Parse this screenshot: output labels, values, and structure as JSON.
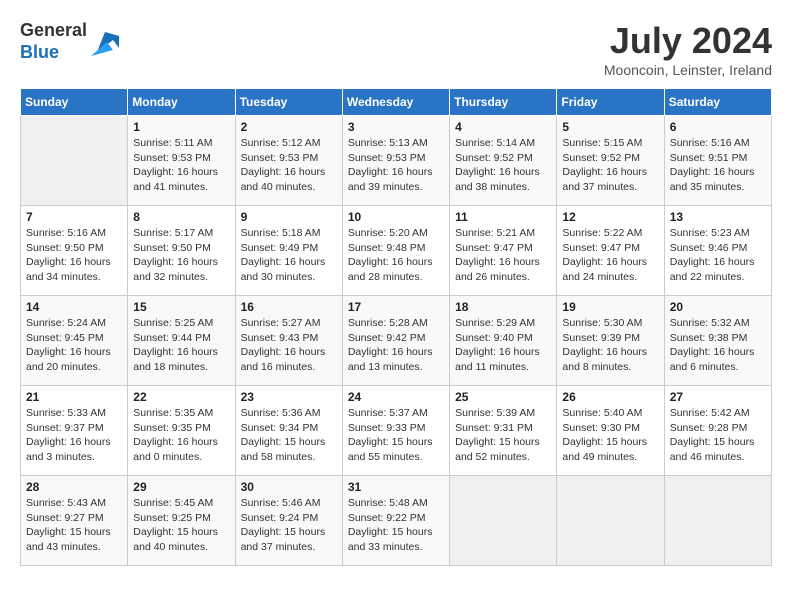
{
  "header": {
    "logo_general": "General",
    "logo_blue": "Blue",
    "month_year": "July 2024",
    "location": "Mooncoin, Leinster, Ireland"
  },
  "days_of_week": [
    "Sunday",
    "Monday",
    "Tuesday",
    "Wednesday",
    "Thursday",
    "Friday",
    "Saturday"
  ],
  "weeks": [
    [
      {
        "day": "",
        "empty": true
      },
      {
        "day": "1",
        "sunrise": "5:11 AM",
        "sunset": "9:53 PM",
        "daylight": "16 hours and 41 minutes."
      },
      {
        "day": "2",
        "sunrise": "5:12 AM",
        "sunset": "9:53 PM",
        "daylight": "16 hours and 40 minutes."
      },
      {
        "day": "3",
        "sunrise": "5:13 AM",
        "sunset": "9:53 PM",
        "daylight": "16 hours and 39 minutes."
      },
      {
        "day": "4",
        "sunrise": "5:14 AM",
        "sunset": "9:52 PM",
        "daylight": "16 hours and 38 minutes."
      },
      {
        "day": "5",
        "sunrise": "5:15 AM",
        "sunset": "9:52 PM",
        "daylight": "16 hours and 37 minutes."
      },
      {
        "day": "6",
        "sunrise": "5:16 AM",
        "sunset": "9:51 PM",
        "daylight": "16 hours and 35 minutes."
      }
    ],
    [
      {
        "day": "7",
        "sunrise": "5:16 AM",
        "sunset": "9:50 PM",
        "daylight": "16 hours and 34 minutes."
      },
      {
        "day": "8",
        "sunrise": "5:17 AM",
        "sunset": "9:50 PM",
        "daylight": "16 hours and 32 minutes."
      },
      {
        "day": "9",
        "sunrise": "5:18 AM",
        "sunset": "9:49 PM",
        "daylight": "16 hours and 30 minutes."
      },
      {
        "day": "10",
        "sunrise": "5:20 AM",
        "sunset": "9:48 PM",
        "daylight": "16 hours and 28 minutes."
      },
      {
        "day": "11",
        "sunrise": "5:21 AM",
        "sunset": "9:47 PM",
        "daylight": "16 hours and 26 minutes."
      },
      {
        "day": "12",
        "sunrise": "5:22 AM",
        "sunset": "9:47 PM",
        "daylight": "16 hours and 24 minutes."
      },
      {
        "day": "13",
        "sunrise": "5:23 AM",
        "sunset": "9:46 PM",
        "daylight": "16 hours and 22 minutes."
      }
    ],
    [
      {
        "day": "14",
        "sunrise": "5:24 AM",
        "sunset": "9:45 PM",
        "daylight": "16 hours and 20 minutes."
      },
      {
        "day": "15",
        "sunrise": "5:25 AM",
        "sunset": "9:44 PM",
        "daylight": "16 hours and 18 minutes."
      },
      {
        "day": "16",
        "sunrise": "5:27 AM",
        "sunset": "9:43 PM",
        "daylight": "16 hours and 16 minutes."
      },
      {
        "day": "17",
        "sunrise": "5:28 AM",
        "sunset": "9:42 PM",
        "daylight": "16 hours and 13 minutes."
      },
      {
        "day": "18",
        "sunrise": "5:29 AM",
        "sunset": "9:40 PM",
        "daylight": "16 hours and 11 minutes."
      },
      {
        "day": "19",
        "sunrise": "5:30 AM",
        "sunset": "9:39 PM",
        "daylight": "16 hours and 8 minutes."
      },
      {
        "day": "20",
        "sunrise": "5:32 AM",
        "sunset": "9:38 PM",
        "daylight": "16 hours and 6 minutes."
      }
    ],
    [
      {
        "day": "21",
        "sunrise": "5:33 AM",
        "sunset": "9:37 PM",
        "daylight": "16 hours and 3 minutes."
      },
      {
        "day": "22",
        "sunrise": "5:35 AM",
        "sunset": "9:35 PM",
        "daylight": "16 hours and 0 minutes."
      },
      {
        "day": "23",
        "sunrise": "5:36 AM",
        "sunset": "9:34 PM",
        "daylight": "15 hours and 58 minutes."
      },
      {
        "day": "24",
        "sunrise": "5:37 AM",
        "sunset": "9:33 PM",
        "daylight": "15 hours and 55 minutes."
      },
      {
        "day": "25",
        "sunrise": "5:39 AM",
        "sunset": "9:31 PM",
        "daylight": "15 hours and 52 minutes."
      },
      {
        "day": "26",
        "sunrise": "5:40 AM",
        "sunset": "9:30 PM",
        "daylight": "15 hours and 49 minutes."
      },
      {
        "day": "27",
        "sunrise": "5:42 AM",
        "sunset": "9:28 PM",
        "daylight": "15 hours and 46 minutes."
      }
    ],
    [
      {
        "day": "28",
        "sunrise": "5:43 AM",
        "sunset": "9:27 PM",
        "daylight": "15 hours and 43 minutes."
      },
      {
        "day": "29",
        "sunrise": "5:45 AM",
        "sunset": "9:25 PM",
        "daylight": "15 hours and 40 minutes."
      },
      {
        "day": "30",
        "sunrise": "5:46 AM",
        "sunset": "9:24 PM",
        "daylight": "15 hours and 37 minutes."
      },
      {
        "day": "31",
        "sunrise": "5:48 AM",
        "sunset": "9:22 PM",
        "daylight": "15 hours and 33 minutes."
      },
      {
        "day": "",
        "empty": true
      },
      {
        "day": "",
        "empty": true
      },
      {
        "day": "",
        "empty": true
      }
    ]
  ]
}
